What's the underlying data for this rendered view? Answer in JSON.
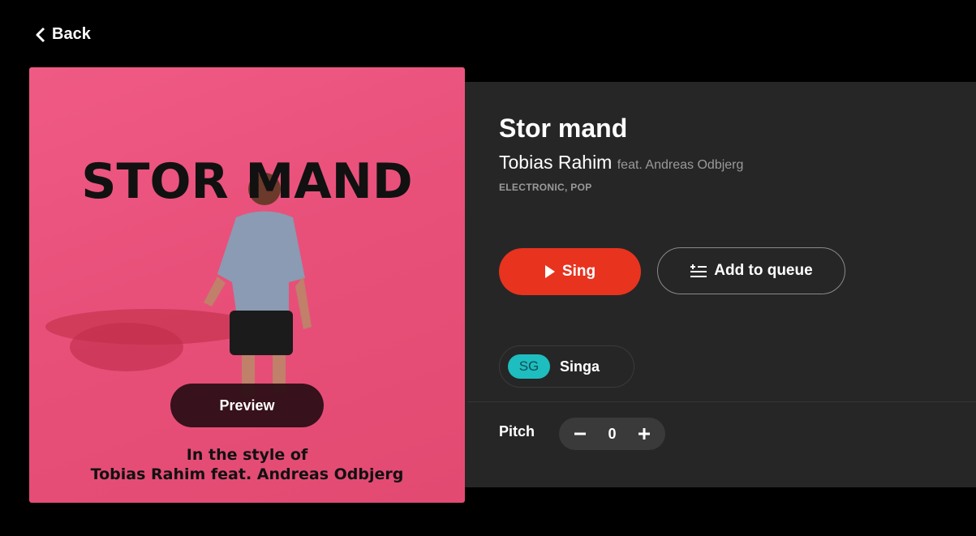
{
  "nav": {
    "back_label": "Back"
  },
  "cover": {
    "title": "STOR MAND",
    "caption_line1": "In the style of",
    "caption_line2": "Tobias Rahim feat. Andreas Odbjerg",
    "preview_label": "Preview"
  },
  "song": {
    "title": "Stor mand",
    "artist": "Tobias Rahim",
    "featuring": "feat. Andreas Odbjerg",
    "genres": "ELECTRONIC, POP"
  },
  "actions": {
    "sing_label": "Sing",
    "queue_label": "Add to queue"
  },
  "source": {
    "badge": "SG",
    "name": "Singa"
  },
  "pitch": {
    "label": "Pitch",
    "value": "0"
  },
  "colors": {
    "accent": "#e8331f",
    "badge": "#1ebdbf",
    "cover_bg": "#e8507a",
    "panel_bg": "#262626"
  },
  "icons": [
    "chevron-left-icon",
    "play-icon",
    "queue-list-icon",
    "minus-icon",
    "plus-icon"
  ]
}
